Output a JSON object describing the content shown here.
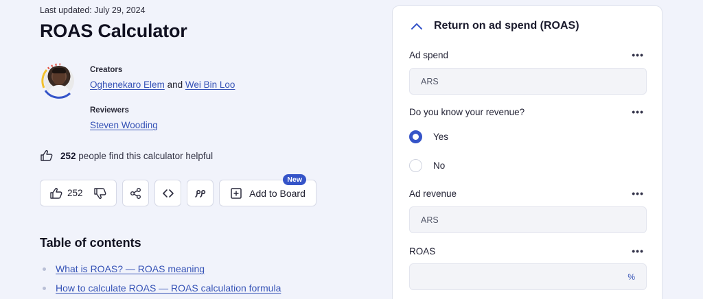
{
  "page": {
    "last_updated": "Last updated: July 29, 2024",
    "title": "ROAS Calculator"
  },
  "authors": {
    "creators_label": "Creators",
    "creator_1": "Oghenekaro Elem",
    "and_text": "and",
    "creator_2": "Wei Bin Loo",
    "reviewers_label": "Reviewers",
    "reviewer_1": "Steven Wooding"
  },
  "helpful": {
    "count": "252",
    "text": "people find this calculator helpful"
  },
  "actions": {
    "vote_count": "252",
    "add_to_board": "Add to Board",
    "new_badge": "New"
  },
  "toc": {
    "title": "Table of contents",
    "items": [
      "What is ROAS? — ROAS meaning",
      "How to calculate ROAS — ROAS calculation formula"
    ]
  },
  "calculator": {
    "section_title": "Return on ad spend (ROAS)",
    "ad_spend_label": "Ad spend",
    "ad_spend_unit": "ARS",
    "know_revenue_label": "Do you know your revenue?",
    "option_yes": "Yes",
    "option_no": "No",
    "selected_option": "Yes",
    "ad_revenue_label": "Ad revenue",
    "ad_revenue_unit": "ARS",
    "roas_label": "ROAS",
    "roas_unit": "%",
    "more_menu": "•••"
  },
  "colors": {
    "accent": "#3554c8",
    "link": "#3552b6",
    "background": "#f1f3fb"
  }
}
